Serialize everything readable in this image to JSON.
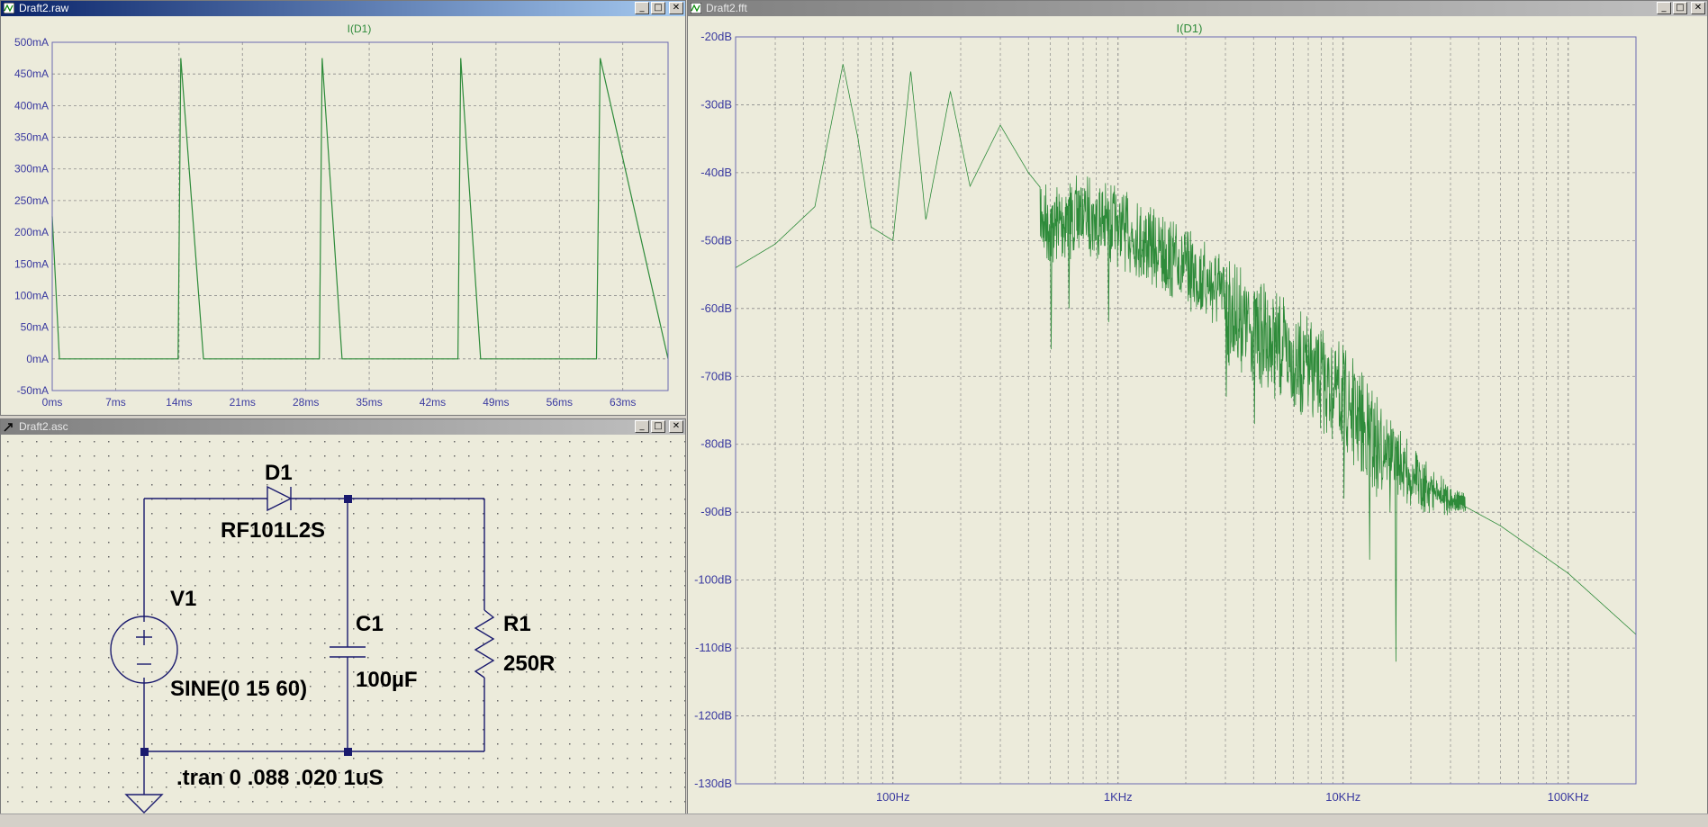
{
  "windows": {
    "raw": {
      "title": "Draft2.raw"
    },
    "fft": {
      "title": "Draft2.fft"
    },
    "asc": {
      "title": "Draft2.asc"
    }
  },
  "controls": {
    "minimize": "_",
    "maximize": "□",
    "close": "✕"
  },
  "colors": {
    "trace": "#2e8b3a",
    "axis_text": "#3a3aa0",
    "grid": "#8a8a8a",
    "frame": "#6a6ab0",
    "wire": "#1a1a6e"
  },
  "raw_plot": {
    "trace_label": "I(D1)",
    "y_ticks": [
      "500mA",
      "450mA",
      "400mA",
      "350mA",
      "300mA",
      "250mA",
      "200mA",
      "150mA",
      "100mA",
      "50mA",
      "0mA",
      "-50mA"
    ],
    "x_ticks": [
      "0ms",
      "7ms",
      "14ms",
      "21ms",
      "28ms",
      "35ms",
      "42ms",
      "49ms",
      "56ms",
      "63ms"
    ]
  },
  "fft_plot": {
    "trace_label": "I(D1)",
    "y_ticks": [
      "-20dB",
      "-30dB",
      "-40dB",
      "-50dB",
      "-60dB",
      "-70dB",
      "-80dB",
      "-90dB",
      "-100dB",
      "-110dB",
      "-120dB",
      "-130dB"
    ],
    "x_ticks": [
      "100Hz",
      "1KHz",
      "10KHz",
      "100KHz"
    ]
  },
  "chart_data": [
    {
      "type": "line",
      "y_unit": "mA",
      "x_unit": "ms",
      "xlim": [
        0,
        68
      ],
      "ylim": [
        -50,
        500
      ],
      "grid": true,
      "series": [
        {
          "name": "I(D1)",
          "x": [
            0,
            0.8,
            13.9,
            14.2,
            16.7,
            29.5,
            29.8,
            32.0,
            44.8,
            45.1,
            47.3,
            60.1,
            60.5,
            68
          ],
          "y": [
            225,
            0,
            0,
            475,
            0,
            0,
            475,
            0,
            0,
            475,
            0,
            0,
            475,
            0
          ]
        }
      ]
    },
    {
      "type": "line",
      "x_scale": "log",
      "y_unit": "dB",
      "xlim": [
        20,
        200000
      ],
      "ylim": [
        -130,
        -20
      ],
      "grid": true,
      "series": [
        {
          "name": "I(D1)",
          "envelope_x": [
            20,
            30,
            45,
            60,
            70,
            80,
            100,
            120,
            140,
            180,
            220,
            300,
            400,
            500,
            700,
            1000,
            2000,
            4000,
            10000,
            20000,
            30000,
            50000,
            100000,
            200000
          ],
          "envelope_y": [
            -54,
            -50.5,
            -45,
            -24,
            -35,
            -48,
            -50,
            -25,
            -47,
            -28,
            -42,
            -33,
            -40,
            -44,
            -42,
            -44,
            -50,
            -57,
            -67,
            -82,
            -88,
            -92,
            -99,
            -108
          ],
          "notch_x": [
            500,
            600,
            900,
            3000,
            4000,
            10000,
            13000,
            16000,
            17000
          ],
          "notch_y": [
            -66,
            -60,
            -62,
            -73,
            -77,
            -88,
            -97,
            -90,
            -112
          ]
        }
      ]
    }
  ],
  "schematic": {
    "d1_name": "D1",
    "d1_value": "RF101L2S",
    "v1_name": "V1",
    "v1_value": "SINE(0 15 60)",
    "c1_name": "C1",
    "c1_value": "100µF",
    "r1_name": "R1",
    "r1_value": "250R",
    "directive": ".tran 0 .088 .020 1uS"
  }
}
